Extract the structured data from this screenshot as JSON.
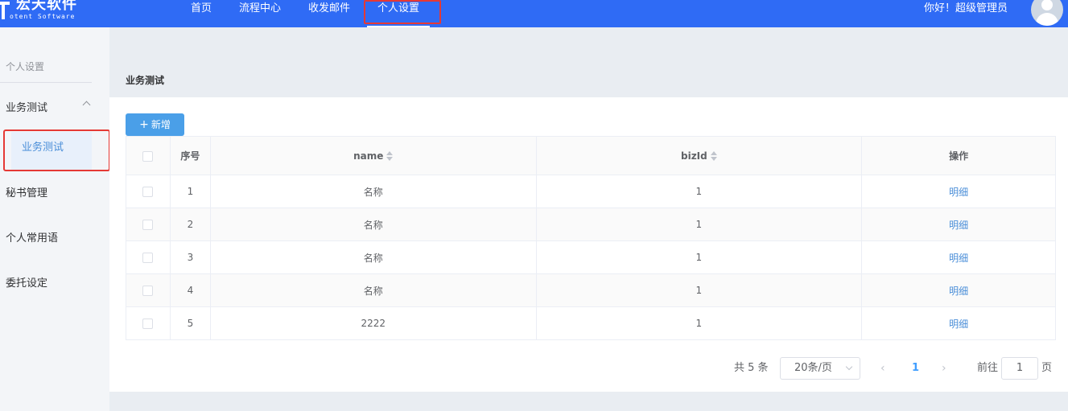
{
  "header": {
    "logo_cn": "宏天软件",
    "logo_en": "otent Software",
    "nav": [
      "首页",
      "流程中心",
      "收发邮件",
      "个人设置"
    ],
    "greeting": "你好！超级管理员"
  },
  "sidebar": {
    "title": "个人设置",
    "group": "业务测试",
    "sub_item": "业务测试",
    "items": [
      "秘书管理",
      "个人常用语",
      "委托设定"
    ]
  },
  "content": {
    "title": "业务测试",
    "add_button": "新增"
  },
  "table": {
    "headers": {
      "index": "序号",
      "name": "name",
      "bizid": "bizId",
      "action": "操作"
    },
    "rows": [
      {
        "index": "1",
        "name": "名称",
        "bizid": "1",
        "action": "明细"
      },
      {
        "index": "2",
        "name": "名称",
        "bizid": "1",
        "action": "明细"
      },
      {
        "index": "3",
        "name": "名称",
        "bizid": "1",
        "action": "明细"
      },
      {
        "index": "4",
        "name": "名称",
        "bizid": "1",
        "action": "明细"
      },
      {
        "index": "5",
        "name": "2222",
        "bizid": "1",
        "action": "明细"
      }
    ]
  },
  "pagination": {
    "total": "共 5 条",
    "page_size": "20条/页",
    "current_page": "1",
    "goto_label": "前往",
    "goto_value": "1",
    "page_suffix": "页"
  },
  "colors": {
    "topbar": "#2f6bf5",
    "accent": "#4a9fe8",
    "link": "#4a8ed8",
    "highlight": "#e53935"
  }
}
